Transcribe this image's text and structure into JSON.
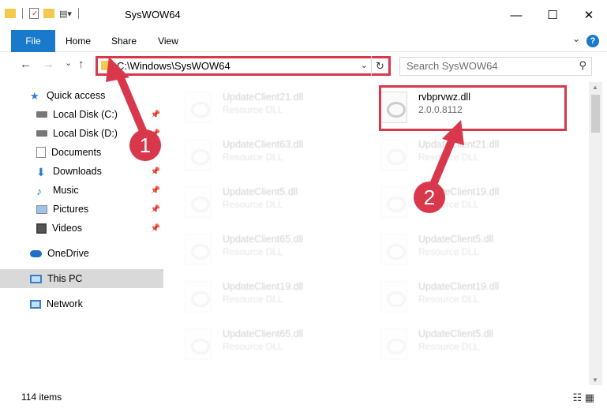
{
  "window": {
    "title": "SysWOW64",
    "minimize": "—",
    "maximize": "☐",
    "close": "✕"
  },
  "ribbon": {
    "tabs": [
      "File",
      "Home",
      "Share",
      "View"
    ],
    "help": "?",
    "expand": "⌄"
  },
  "nav": {
    "back": "←",
    "forward": "→",
    "recent": "⌄",
    "up": "↑"
  },
  "address": {
    "path": "C:\\Windows\\SysWOW64",
    "dropdown": "⌄",
    "refresh": "↻"
  },
  "search": {
    "placeholder": "Search SysWOW64",
    "icon": "⚲"
  },
  "sidebar": {
    "items": [
      {
        "label": "Quick access",
        "icon": "star-icon"
      },
      {
        "label": "Local Disk (C:)",
        "icon": "drive-icon",
        "pinned": true
      },
      {
        "label": "Local Disk (D:)",
        "icon": "drive-icon",
        "pinned": true
      },
      {
        "label": "Documents",
        "icon": "documents-icon",
        "pinned": true
      },
      {
        "label": "Downloads",
        "icon": "download-icon",
        "pinned": true
      },
      {
        "label": "Music",
        "icon": "music-icon",
        "pinned": true
      },
      {
        "label": "Pictures",
        "icon": "pictures-icon",
        "pinned": true
      },
      {
        "label": "Videos",
        "icon": "videos-icon",
        "pinned": true
      },
      {
        "label": "OneDrive",
        "icon": "cloud-icon"
      },
      {
        "label": "This PC",
        "icon": "computer-icon",
        "selected": true
      },
      {
        "label": "Network",
        "icon": "network-icon"
      }
    ]
  },
  "files": {
    "left": [
      {
        "name": "UpdateClient21.dll",
        "type": "Resource DLL"
      },
      {
        "name": "UpdateClient63.dll",
        "type": "Resource DLL"
      },
      {
        "name": "UpdateClient5.dll",
        "type": "Resource DLL"
      },
      {
        "name": "UpdateClient65.dll",
        "type": "Resource DLL"
      },
      {
        "name": "UpdateClient19.dll",
        "type": "Resource DLL"
      },
      {
        "name": "UpdateClient65.dll",
        "type": "Resource DLL"
      }
    ],
    "right": [
      {
        "name": "rvbprvwz.dll",
        "type": "2.0.0.8112"
      },
      {
        "name": "UpdateClient21.dll",
        "type": "Resource DLL"
      },
      {
        "name": "UpdateClient19.dll",
        "type": "Resource DLL"
      },
      {
        "name": "UpdateClient5.dll",
        "type": "Resource DLL"
      },
      {
        "name": "UpdateClient19.dll",
        "type": "Resource DLL"
      },
      {
        "name": "UpdateClient5.dll",
        "type": "Resource DLL"
      }
    ]
  },
  "status": {
    "count": "114 items",
    "views": "☷ ▦"
  },
  "annotations": {
    "step1": "1",
    "step2": "2",
    "color": "#d9374b"
  }
}
